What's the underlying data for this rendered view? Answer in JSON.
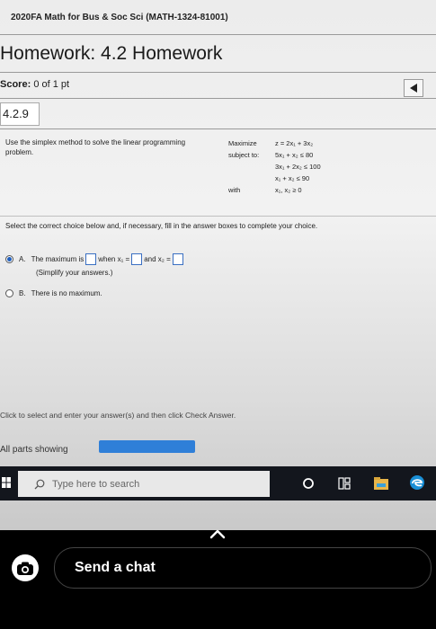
{
  "course": "2020FA Math for Bus & Soc Sci (MATH-1324-81001)",
  "title": "Homework: 4.2 Homework",
  "score": {
    "label": "Score:",
    "value": "0 of 1 pt"
  },
  "question_number": "4.2.9",
  "instructions": "Use the simplex method to solve the linear programming problem.",
  "problem": {
    "maximize_label": "Maximize",
    "objective": "z = 2x₁ + 3x₂",
    "subject_to_label": "subject to:",
    "constraints": [
      "5x₁ + x₂ ≤ 80",
      "3x₁ + 2x₂ ≤ 100",
      "x₁ + x₂ ≤ 90"
    ],
    "with_label": "with",
    "nonneg": "x₁, x₂ ≥ 0"
  },
  "select_instruction": "Select the correct choice below and, if necessary, fill in the answer boxes to complete your choice.",
  "choice_a": {
    "letter": "A.",
    "part1": "The maximum is",
    "part2": "when x₁ =",
    "part3": "and x₂ =",
    "note": "(Simplify your answers.)"
  },
  "choice_b": {
    "letter": "B.",
    "text": "There is no maximum."
  },
  "footer_hint": "Click to select and enter your answer(s) and then click Check Answer.",
  "parts_showing": "All parts showing",
  "progress_fraction": 1.0,
  "taskbar": {
    "search_placeholder": "Type here to search"
  },
  "chat_placeholder": "Send a chat",
  "colors": {
    "accent": "#2f7fd8",
    "taskbar": "#13161d"
  }
}
